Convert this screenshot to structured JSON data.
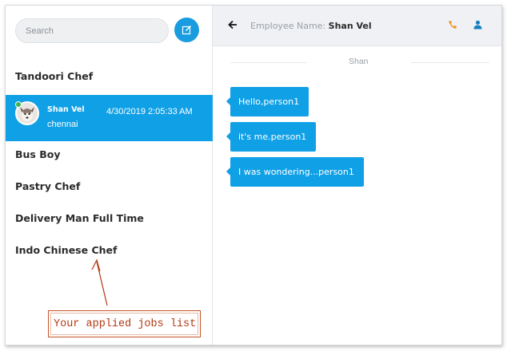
{
  "search": {
    "placeholder": "Search"
  },
  "jobs": [
    {
      "label": "Tandoori Chef"
    },
    {
      "label": "Bus Boy"
    },
    {
      "label": "Pastry Chef"
    },
    {
      "label": "Delivery Man Full Time"
    },
    {
      "label": "Indo Chinese Chef"
    }
  ],
  "active_contact": {
    "name": "Shan Vel",
    "location": "chennai",
    "timestamp": "4/30/2019 2:05:33 AM",
    "status": "online"
  },
  "annotation": {
    "text": "Your applied jobs list"
  },
  "chat": {
    "header_label": "Employee Name:",
    "header_name": "Shan Vel",
    "divider_label": "Shan",
    "messages": [
      {
        "text": "Hello,person1"
      },
      {
        "text": "it's me.person1"
      },
      {
        "text": "I was wondering...person1"
      }
    ]
  },
  "icons": {
    "compose": "compose-icon",
    "back": "arrow-left-icon",
    "phone": "phone-icon",
    "user": "user-icon"
  },
  "colors": {
    "accent": "#10a0e6",
    "phone_icon": "#f0932b",
    "user_icon": "#1a7fc1",
    "online": "#3cb54a",
    "annotation": "#c0562b"
  }
}
